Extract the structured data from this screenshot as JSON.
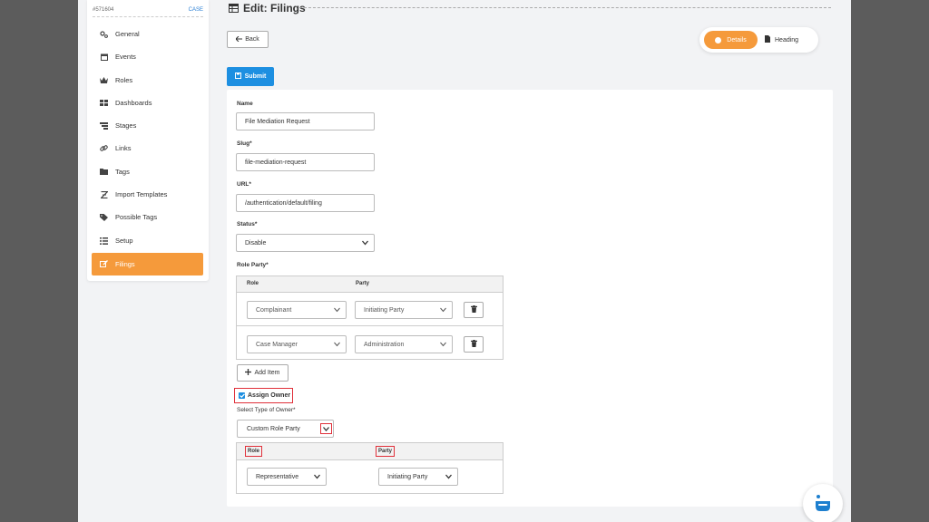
{
  "sidebar": {
    "case_id": "#571604",
    "case_link": "CASE",
    "items": [
      {
        "label": "General",
        "icon": "cogs-icon"
      },
      {
        "label": "Events",
        "icon": "calendar-icon"
      },
      {
        "label": "Roles",
        "icon": "crown-icon"
      },
      {
        "label": "Dashboards",
        "icon": "dashboard-icon"
      },
      {
        "label": "Stages",
        "icon": "stages-icon"
      },
      {
        "label": "Links",
        "icon": "link-icon"
      },
      {
        "label": "Tags",
        "icon": "folder-icon"
      },
      {
        "label": "Import Templates",
        "icon": "import-icon"
      },
      {
        "label": "Possible Tags",
        "icon": "tag-icon"
      },
      {
        "label": "Setup",
        "icon": "list-icon"
      },
      {
        "label": "Filings",
        "icon": "edit-icon",
        "active": true
      }
    ]
  },
  "header": {
    "title": "Edit: Filings",
    "back_label": "Back",
    "tabs": [
      {
        "label": "Details",
        "active": true
      },
      {
        "label": "Heading",
        "active": false
      }
    ],
    "submit_label": "Submit"
  },
  "form": {
    "name_label": "Name",
    "name_value": "File Mediation Request",
    "slug_label": "Slug*",
    "slug_value": "file-mediation-request",
    "url_label": "URL*",
    "url_value": "/authentication/default/filing",
    "status_label": "Status*",
    "status_value": "Disable",
    "role_party_label": "Role Party*",
    "role_party_table": {
      "headers": [
        "Role",
        "Party"
      ],
      "rows": [
        {
          "role": "Complainant",
          "party": "Initiating Party"
        },
        {
          "role": "Case Manager",
          "party": "Administration"
        }
      ]
    },
    "add_item_label": "Add Item",
    "assign_owner_label": "Assign Owner",
    "assign_owner_checked": true,
    "owner_type_label": "Select Type of Owner*",
    "owner_type_value": "Custom Role Party",
    "owner_table": {
      "headers": [
        "Role",
        "Party"
      ],
      "role_value": "Representative",
      "party_value": "Initiating Party"
    }
  },
  "colors": {
    "accent": "#f59a3b",
    "primary": "#1d8fe1",
    "highlight": "#e0303a"
  }
}
